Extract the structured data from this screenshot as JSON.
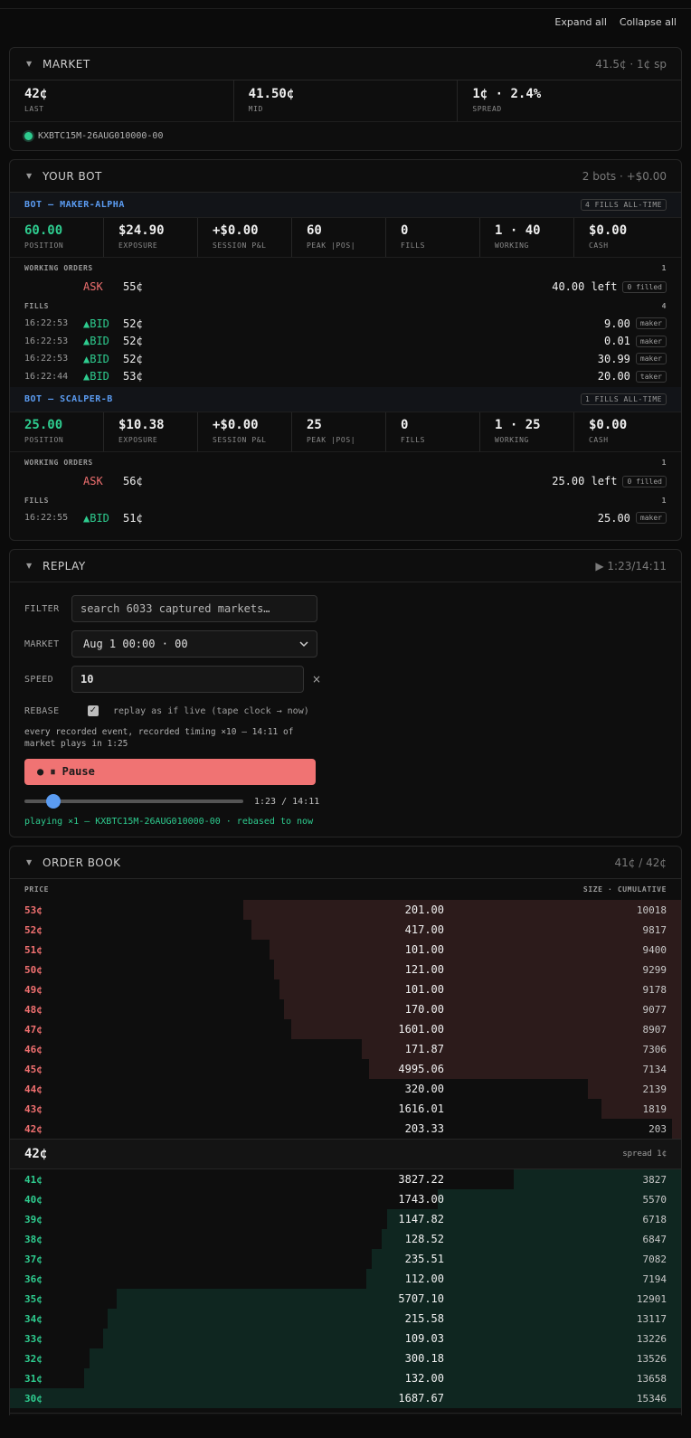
{
  "toolbar": {
    "expand_all": "Expand all",
    "collapse_all": "Collapse all"
  },
  "market": {
    "title": "MARKET",
    "meta": "41.5¢ · 1¢ sp",
    "stats": [
      {
        "value": "42¢",
        "label": "LAST"
      },
      {
        "value": "41.50¢",
        "label": "MID"
      },
      {
        "value": "1¢ · 2.4%",
        "label": "SPREAD"
      }
    ],
    "ticker": "KXBTC15M-26AUG010000-00"
  },
  "bot": {
    "title": "YOUR BOT",
    "meta": "2 bots · +$0.00",
    "working_label": "WORKING ORDERS",
    "fills_label": "FILLS",
    "bots": [
      {
        "name": "BOT — MAKER-ALPHA",
        "badge": "4 FILLS ALL-TIME",
        "stats": [
          {
            "value": "60.00",
            "label": "POSITION"
          },
          {
            "value": "$24.90",
            "label": "EXPOSURE"
          },
          {
            "value": "+$0.00",
            "label": "SESSION P&L"
          },
          {
            "value": "60",
            "label": "PEAK |POS|"
          },
          {
            "value": "0",
            "label": "FILLS"
          },
          {
            "value": "1 · 40",
            "label": "WORKING"
          },
          {
            "value": "$0.00",
            "label": "CASH"
          }
        ],
        "working_count": "1",
        "orders": [
          {
            "side": "ASK",
            "price": "55¢",
            "left": "40.00 left",
            "filled": "0 filled"
          }
        ],
        "fills_count": "4",
        "fills": [
          {
            "time": "16:22:53",
            "side": "▲BID",
            "price": "52¢",
            "qty": "9.00",
            "kind": "maker"
          },
          {
            "time": "16:22:53",
            "side": "▲BID",
            "price": "52¢",
            "qty": "0.01",
            "kind": "maker"
          },
          {
            "time": "16:22:53",
            "side": "▲BID",
            "price": "52¢",
            "qty": "30.99",
            "kind": "maker"
          },
          {
            "time": "16:22:44",
            "side": "▲BID",
            "price": "53¢",
            "qty": "20.00",
            "kind": "taker"
          }
        ]
      },
      {
        "name": "BOT — SCALPER-B",
        "badge": "1 FILLS ALL-TIME",
        "stats": [
          {
            "value": "25.00",
            "label": "POSITION"
          },
          {
            "value": "$10.38",
            "label": "EXPOSURE"
          },
          {
            "value": "+$0.00",
            "label": "SESSION P&L"
          },
          {
            "value": "25",
            "label": "PEAK |POS|"
          },
          {
            "value": "0",
            "label": "FILLS"
          },
          {
            "value": "1 · 25",
            "label": "WORKING"
          },
          {
            "value": "$0.00",
            "label": "CASH"
          }
        ],
        "working_count": "1",
        "orders": [
          {
            "side": "ASK",
            "price": "56¢",
            "left": "25.00 left",
            "filled": "0 filled"
          }
        ],
        "fills_count": "1",
        "fills": [
          {
            "time": "16:22:55",
            "side": "▲BID",
            "price": "51¢",
            "qty": "25.00",
            "kind": "maker"
          }
        ]
      }
    ]
  },
  "replay": {
    "title": "REPLAY",
    "meta": "▶ 1:23/14:11",
    "filter_label": "FILTER",
    "filter_placeholder": "search 6033 captured markets…",
    "market_label": "MARKET",
    "market_value": "Aug 1 00:00 · 00",
    "speed_label": "SPEED",
    "speed_value": "10",
    "speed_clear": "×",
    "rebase_label": "REBASE",
    "rebase_text": "replay as if live (tape clock → now)",
    "note": "every recorded event, recorded timing ×10 — 14:11 of market plays in 1:25",
    "pause_label": "● ⏸ Pause",
    "progress": 0.0975,
    "slider_time": "1:23 / 14:11",
    "status": "playing ×1 — KXBTC15M-26AUG010000-00 · rebased to now"
  },
  "orderbook": {
    "title": "ORDER BOOK",
    "meta": "41¢ / 42¢",
    "price_header": "PRICE",
    "size_header": "SIZE · CUMULATIVE",
    "max_cumulative": 15346,
    "asks": [
      {
        "price": "53¢",
        "size": "201.00",
        "cum": 10018
      },
      {
        "price": "52¢",
        "size": "417.00",
        "cum": 9817
      },
      {
        "price": "51¢",
        "size": "101.00",
        "cum": 9400
      },
      {
        "price": "50¢",
        "size": "121.00",
        "cum": 9299
      },
      {
        "price": "49¢",
        "size": "101.00",
        "cum": 9178
      },
      {
        "price": "48¢",
        "size": "170.00",
        "cum": 9077
      },
      {
        "price": "47¢",
        "size": "1601.00",
        "cum": 8907
      },
      {
        "price": "46¢",
        "size": "171.87",
        "cum": 7306
      },
      {
        "price": "45¢",
        "size": "4995.06",
        "cum": 7134
      },
      {
        "price": "44¢",
        "size": "320.00",
        "cum": 2139
      },
      {
        "price": "43¢",
        "size": "1616.01",
        "cum": 1819
      },
      {
        "price": "42¢",
        "size": "203.33",
        "cum": 203
      }
    ],
    "mid_price": "42¢",
    "spread": "spread 1¢",
    "bids": [
      {
        "price": "41¢",
        "size": "3827.22",
        "cum": 3827
      },
      {
        "price": "40¢",
        "size": "1743.00",
        "cum": 5570
      },
      {
        "price": "39¢",
        "size": "1147.82",
        "cum": 6718
      },
      {
        "price": "38¢",
        "size": "128.52",
        "cum": 6847
      },
      {
        "price": "37¢",
        "size": "235.51",
        "cum": 7082
      },
      {
        "price": "36¢",
        "size": "112.00",
        "cum": 7194
      },
      {
        "price": "35¢",
        "size": "5707.10",
        "cum": 12901
      },
      {
        "price": "34¢",
        "size": "215.58",
        "cum": 13117
      },
      {
        "price": "33¢",
        "size": "109.03",
        "cum": 13226
      },
      {
        "price": "32¢",
        "size": "300.18",
        "cum": 13526
      },
      {
        "price": "31¢",
        "size": "132.00",
        "cum": 13658
      },
      {
        "price": "30¢",
        "size": "1687.67",
        "cum": 15346
      }
    ]
  }
}
